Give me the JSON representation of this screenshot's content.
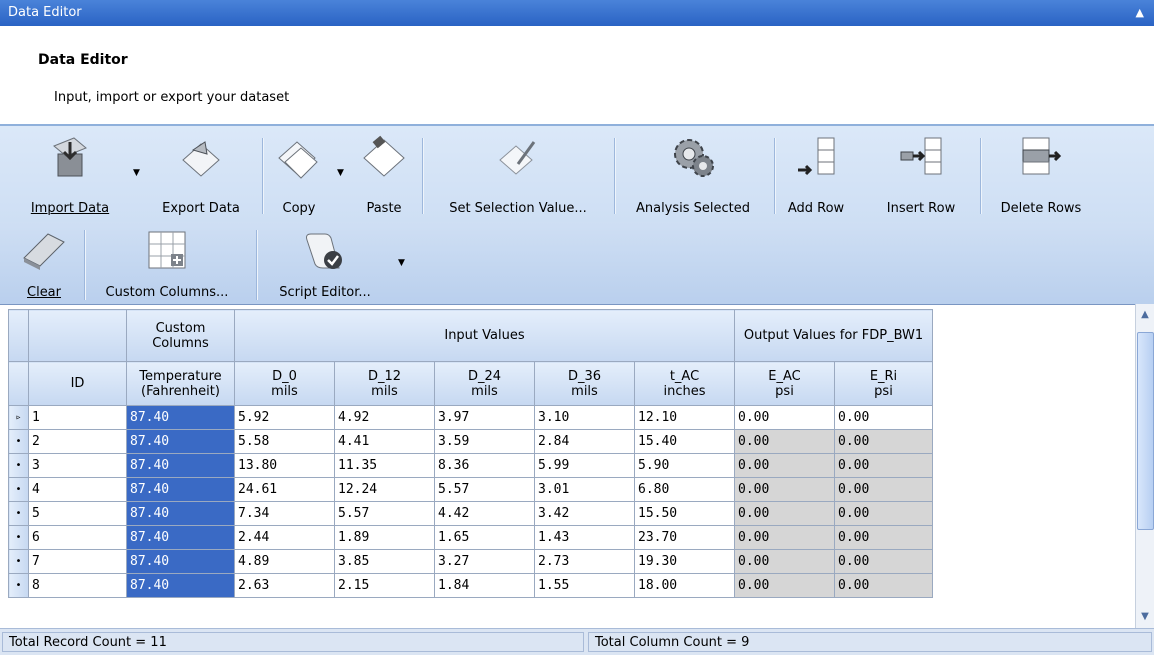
{
  "window": {
    "title": "Data Editor"
  },
  "header": {
    "title": "Data Editor",
    "subtitle": "Input, import or export your dataset"
  },
  "toolbar": {
    "import_data": "Import Data",
    "export_data": "Export Data",
    "copy": "Copy",
    "paste": "Paste",
    "set_selection_value": "Set Selection Value...",
    "analysis_selected": "Analysis Selected",
    "add_row": "Add Row",
    "insert_row": "Insert Row",
    "delete_rows": "Delete Rows",
    "clear": "Clear",
    "custom_columns": "Custom Columns...",
    "script_editor": "Script Editor..."
  },
  "grid": {
    "groups": {
      "custom": "Custom Columns",
      "input": "Input Values",
      "output": "Output Values for FDP_BW1"
    },
    "columns": [
      {
        "name": "ID",
        "unit": ""
      },
      {
        "name": "Temperature",
        "unit": "(Fahrenheit)"
      },
      {
        "name": "D_0",
        "unit": "mils"
      },
      {
        "name": "D_12",
        "unit": "mils"
      },
      {
        "name": "D_24",
        "unit": "mils"
      },
      {
        "name": "D_36",
        "unit": "mils"
      },
      {
        "name": "t_AC",
        "unit": "inches"
      },
      {
        "name": "E_AC",
        "unit": "psi"
      },
      {
        "name": "E_Ri",
        "unit": "psi"
      }
    ],
    "rows": [
      [
        "1",
        "87.40",
        "5.92",
        "4.92",
        "3.97",
        "3.10",
        "12.10",
        "0.00",
        "0.00"
      ],
      [
        "2",
        "87.40",
        "5.58",
        "4.41",
        "3.59",
        "2.84",
        "15.40",
        "0.00",
        "0.00"
      ],
      [
        "3",
        "87.40",
        "13.80",
        "11.35",
        "8.36",
        "5.99",
        "5.90",
        "0.00",
        "0.00"
      ],
      [
        "4",
        "87.40",
        "24.61",
        "12.24",
        "5.57",
        "3.01",
        "6.80",
        "0.00",
        "0.00"
      ],
      [
        "5",
        "87.40",
        "7.34",
        "5.57",
        "4.42",
        "3.42",
        "15.50",
        "0.00",
        "0.00"
      ],
      [
        "6",
        "87.40",
        "2.44",
        "1.89",
        "1.65",
        "1.43",
        "23.70",
        "0.00",
        "0.00"
      ],
      [
        "7",
        "87.40",
        "4.89",
        "3.85",
        "3.27",
        "2.73",
        "19.30",
        "0.00",
        "0.00"
      ],
      [
        "8",
        "87.40",
        "2.63",
        "2.15",
        "1.84",
        "1.55",
        "18.00",
        "0.00",
        "0.00"
      ]
    ]
  },
  "status": {
    "record_count": "Total Record Count = 11",
    "column_count": "Total Column Count = 9"
  },
  "colors": {
    "accent": "#2a63c4",
    "selection": "#3a6ac5",
    "output_cell": "#d6d6d6"
  }
}
